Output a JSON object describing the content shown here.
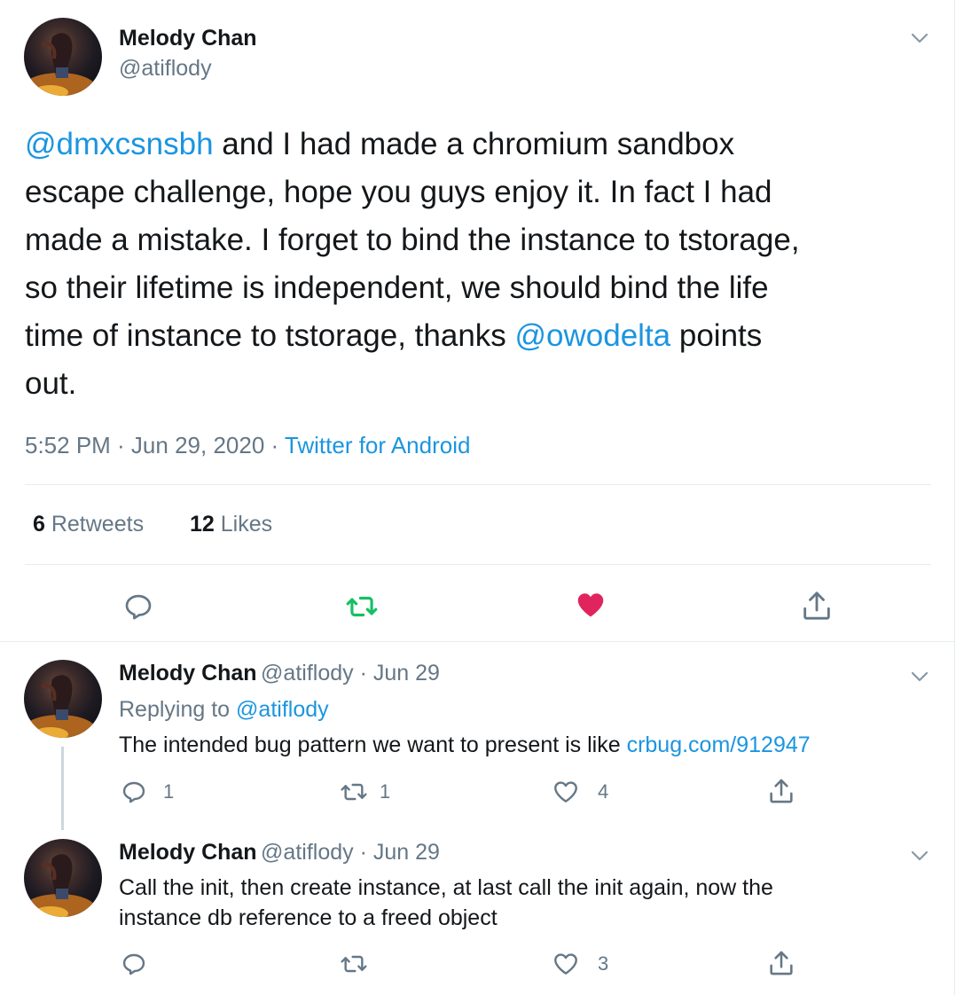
{
  "main_tweet": {
    "author_name": "Melody Chan",
    "author_handle": "@atiflody",
    "text_mention": "@dmxcsnsbh",
    "text_line1": " and I had made a chromium sandbox",
    "text_line2": "escape challenge, hope you guys enjoy it. In fact I had",
    "text_line3": "made a mistake. I forget to bind the instance to tstorage,",
    "text_line4": "so their lifetime is independent, we should bind the life",
    "text_line5a": "time of instance to tstorage, thanks ",
    "text_mention2": "@owodelta",
    "text_line5b": " points",
    "text_line6": "out.",
    "time": "5:52 PM · Jun 29, 2020 · ",
    "source": "Twitter for Android",
    "retweets_count": "6",
    "retweets_label": " Retweets",
    "likes_count": "12",
    "likes_label": " Likes"
  },
  "replies": [
    {
      "author_name": "Melody Chan",
      "author_handle": "@atiflody",
      "date": " · Jun 29",
      "replying_label": "Replying to ",
      "replying_to": "@atiflody",
      "text": "The intended bug pattern we want to present is like ",
      "link": "crbug.com/912947",
      "reply_count": "1",
      "retweet_count": "1",
      "like_count": "4"
    },
    {
      "author_name": "Melody Chan",
      "author_handle": "@atiflody",
      "date": " · Jun 29",
      "text_line1": "Call the init, then create instance, at last call the init again, now the",
      "text_line2": "instance db reference to a freed object",
      "like_count": "3"
    }
  ],
  "colors": {
    "accent": "#1b95e0",
    "retweet_green": "#17bf63",
    "like_red": "#e0245e",
    "muted": "#657786"
  }
}
